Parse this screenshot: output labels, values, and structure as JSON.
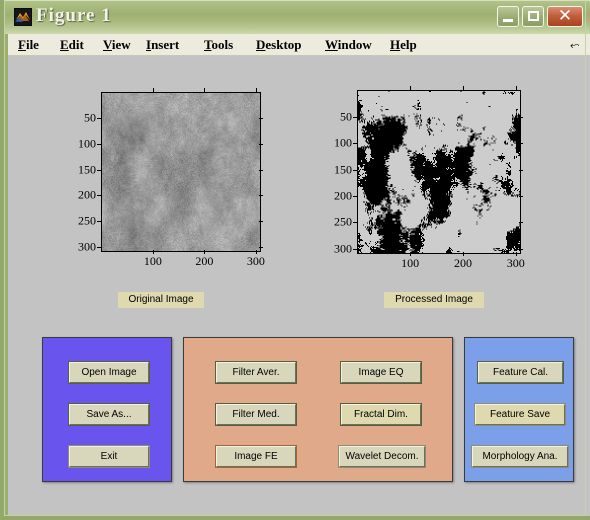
{
  "window": {
    "title": "Figure 1",
    "icon": "matlab-membrane-icon",
    "controls": {
      "minimize_label": "_",
      "maximize_label": "□",
      "close_label": "✕"
    },
    "frame_color": "#93a86a",
    "titlebar_color": "#9eb173",
    "canvas_color": "#c3c3c3"
  },
  "menubar": {
    "items": [
      {
        "label": "File",
        "mnemonic": "F",
        "rest": "ile"
      },
      {
        "label": "Edit",
        "mnemonic": "E",
        "rest": "dit"
      },
      {
        "label": "View",
        "mnemonic": "V",
        "rest": "iew"
      },
      {
        "label": "Insert",
        "mnemonic": "I",
        "rest": "nsert"
      },
      {
        "label": "Tools",
        "mnemonic": "T",
        "rest": "ools"
      },
      {
        "label": "Desktop",
        "mnemonic": "D",
        "rest": "esktop"
      },
      {
        "label": "Window",
        "mnemonic": "W",
        "rest": "indow"
      },
      {
        "label": "Help",
        "mnemonic": "H",
        "rest": "elp"
      }
    ],
    "dock_glyph": "⬿"
  },
  "axes": {
    "left": {
      "name": "original-image-axes",
      "yticks": [
        "50",
        "100",
        "150",
        "200",
        "250",
        "300"
      ],
      "xticks": [
        "100",
        "200",
        "300"
      ],
      "xlim": [
        0,
        320
      ],
      "ylim": [
        0,
        320
      ],
      "image_kind": "grayscale-texture"
    },
    "right": {
      "name": "processed-image-axes",
      "yticks": [
        "50",
        "100",
        "150",
        "200",
        "250",
        "300"
      ],
      "xticks": [
        "100",
        "200",
        "300"
      ],
      "xlim": [
        0,
        320
      ],
      "ylim": [
        0,
        320
      ],
      "image_kind": "binary-threshold-texture"
    }
  },
  "captions": {
    "original": "Original Image",
    "processed": "Processed Image",
    "background_color": "#ded9ae"
  },
  "panels": {
    "file_panel": {
      "name": "file-panel",
      "color": "#6a54ee",
      "buttons": [
        {
          "label": "Open Image"
        },
        {
          "label": "Save As..."
        },
        {
          "label": "Exit"
        }
      ]
    },
    "process_panel": {
      "name": "processing-panel",
      "color": "#e0a98a",
      "buttons": [
        {
          "label": "Filter Aver."
        },
        {
          "label": "Image EQ"
        },
        {
          "label": "Filter Med."
        },
        {
          "label": "Fractal Dim."
        },
        {
          "label": "Image FE"
        },
        {
          "label": "Wavelet Decom."
        }
      ]
    },
    "feature_panel": {
      "name": "feature-panel",
      "color": "#7b9fe8",
      "buttons": [
        {
          "label": "Feature Cal."
        },
        {
          "label": "Feature Save"
        },
        {
          "label": "Morphology Ana."
        }
      ]
    }
  }
}
